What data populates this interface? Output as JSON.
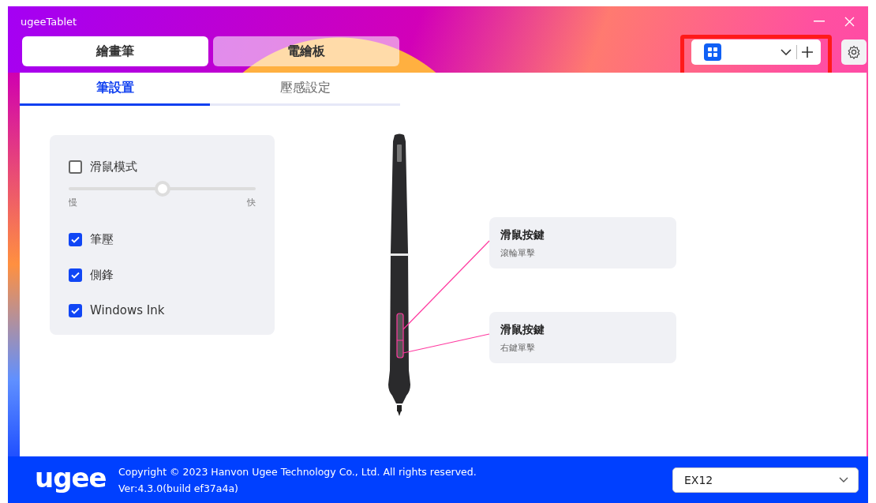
{
  "window": {
    "title": "ugeeTablet"
  },
  "main_tabs": [
    {
      "label": "繪畫筆",
      "selected": true
    },
    {
      "label": "電繪板",
      "selected": false
    }
  ],
  "sub_tabs": [
    {
      "label": "筆設置",
      "selected": true
    },
    {
      "label": "壓感設定",
      "selected": false
    }
  ],
  "pen_settings": {
    "mouse_mode": {
      "label": "滑鼠模式",
      "checked": false
    },
    "speed": {
      "level": 0.5,
      "min_label": "慢",
      "max_label": "快"
    },
    "options": [
      {
        "label": "筆壓",
        "checked": true
      },
      {
        "label": "側鋒",
        "checked": true
      },
      {
        "label": "Windows Ink",
        "checked": true
      }
    ]
  },
  "pen_buttons": [
    {
      "title": "滑鼠按鍵",
      "action": "滾輪單擊"
    },
    {
      "title": "滑鼠按鍵",
      "action": "右鍵單擊"
    }
  ],
  "footer": {
    "logo": "ugee",
    "copyright": "Copyright © 2023 Hanvon Ugee Technology Co., Ltd. All rights reserved.",
    "version": "Ver:4.3.0(build ef37a4a)",
    "device_select": {
      "value": "EX12"
    }
  }
}
